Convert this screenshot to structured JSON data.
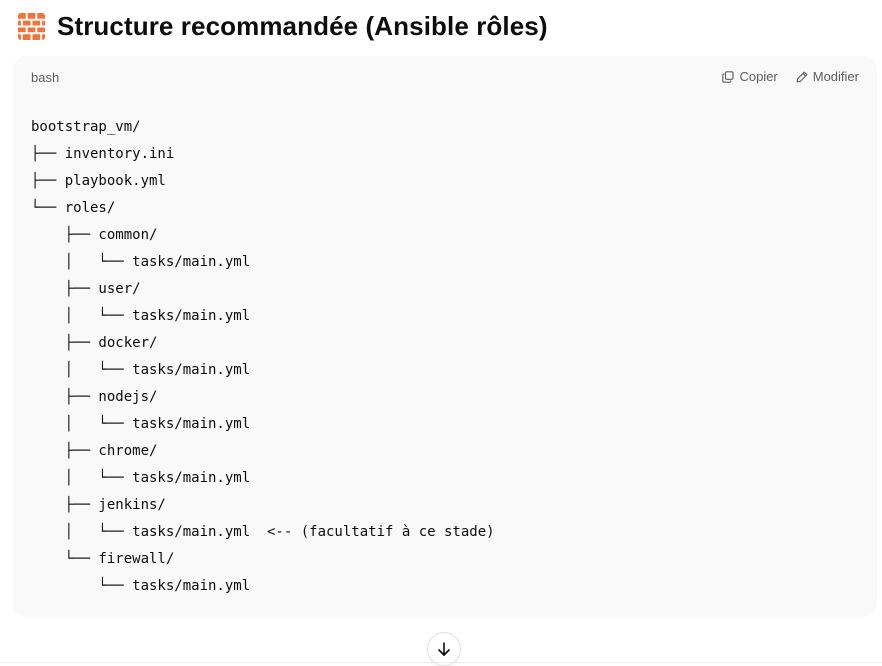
{
  "heading": {
    "icon": "brick-wall-icon",
    "title": "Structure recommandée (Ansible rôles)"
  },
  "code_block": {
    "language": "bash",
    "actions": {
      "copy_label": "Copier",
      "copy_icon": "copy-icon",
      "edit_label": "Modifier",
      "edit_icon": "pencil-icon"
    },
    "lines": [
      "bootstrap_vm/",
      "├── inventory.ini",
      "├── playbook.yml",
      "└── roles/",
      "    ├── common/",
      "    │   └── tasks/main.yml",
      "    ├── user/",
      "    │   └── tasks/main.yml",
      "    ├── docker/",
      "    │   └── tasks/main.yml",
      "    ├── nodejs/",
      "    │   └── tasks/main.yml",
      "    ├── chrome/",
      "    │   └── tasks/main.yml",
      "    ├── jenkins/",
      "    │   └── tasks/main.yml  <-- (facultatif à ce stade)",
      "    └── firewall/",
      "        └── tasks/main.yml"
    ]
  },
  "scroll_button": {
    "icon": "arrow-down-icon"
  },
  "colors": {
    "code_background": "#f9f9f9",
    "brick_orange": "#f4733a",
    "muted_text": "#5d5d5d"
  }
}
